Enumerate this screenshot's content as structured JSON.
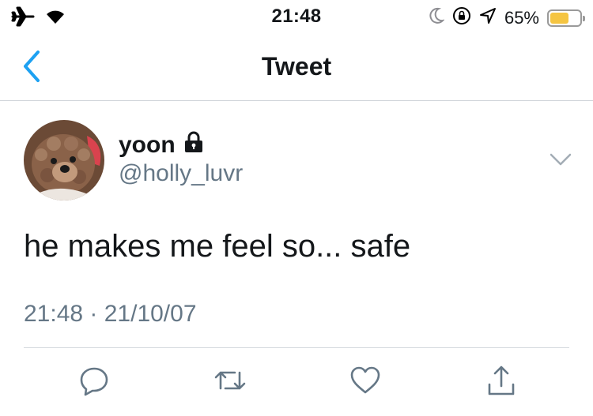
{
  "status_bar": {
    "time": "21:48",
    "battery_percent_label": "65%",
    "battery_level": 0.65,
    "battery_color": "#f5c542",
    "icons": [
      "airplane-icon",
      "wifi-icon",
      "moon-icon",
      "orientation-lock-icon",
      "location-arrow-icon",
      "battery-icon"
    ]
  },
  "nav": {
    "title": "Tweet",
    "back_icon": "chevron-left-icon",
    "accent_color": "#1da1f2"
  },
  "tweet": {
    "display_name": "yoon",
    "protected_icon": "lock-icon",
    "handle": "@holly_luvr",
    "text": "he makes me feel so... safe",
    "timestamp": "21:48 · 21/10/07",
    "menu_icon": "chevron-down-icon"
  },
  "actions": [
    {
      "name": "reply",
      "icon": "reply-icon"
    },
    {
      "name": "retweet",
      "icon": "retweet-icon"
    },
    {
      "name": "like",
      "icon": "heart-icon"
    },
    {
      "name": "share",
      "icon": "share-icon"
    }
  ],
  "colors": {
    "text": "#14171a",
    "secondary_text": "#657786",
    "icon_gray": "#657786"
  }
}
